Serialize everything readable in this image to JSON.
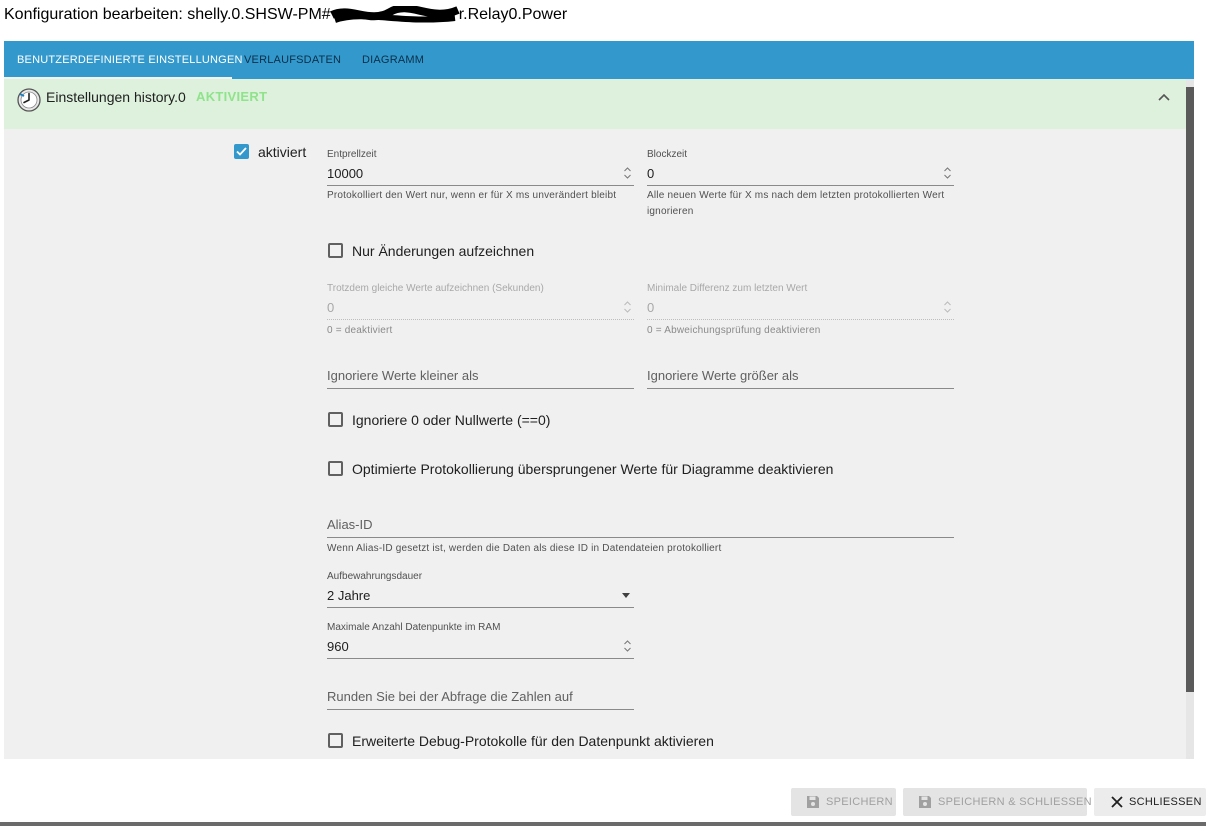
{
  "dialog": {
    "title_prefix": "Konfiguration bearbeiten: shelly.0.SHSW-PM#",
    "title_suffix": "r.Relay0.Power"
  },
  "tabs": [
    {
      "label": "BENUTZERDEFINIERTE EINSTELLUNGEN",
      "active": true
    },
    {
      "label": "VERLAUFSDATEN",
      "active": false
    },
    {
      "label": "DIAGRAMM",
      "active": false
    }
  ],
  "accordion": {
    "title": "Einstellungen history.0",
    "status": "AKTIVIERT",
    "icon": "history-clock-icon",
    "status_color": "#8fe38b"
  },
  "form": {
    "enabled": {
      "label": "aktiviert",
      "checked": true
    },
    "debounce": {
      "label": "Entprellzeit",
      "value": "10000",
      "helper": "Protokolliert den Wert nur, wenn er für X ms unverändert bleibt"
    },
    "blocktime": {
      "label": "Blockzeit",
      "value": "0",
      "helper": "Alle neuen Werte für X ms nach dem letzten protokollierten Wert ignorieren"
    },
    "changes_only": {
      "label": "Nur Änderungen aufzeichnen",
      "checked": false
    },
    "change_interval": {
      "label": "Trotzdem gleiche Werte aufzeichnen (Sekunden)",
      "value": "0",
      "helper": "0 = deaktiviert"
    },
    "min_diff": {
      "label": "Minimale Differenz zum letzten Wert",
      "value": "0",
      "helper": "0 = Abweichungsprüfung deaktivieren"
    },
    "ignore_below": {
      "placeholder": "Ignoriere Werte kleiner als"
    },
    "ignore_above": {
      "placeholder": "Ignoriere Werte größer als"
    },
    "ignore_zero": {
      "label": "Ignoriere 0 oder Nullwerte (==0)",
      "checked": false
    },
    "disable_skipped": {
      "label": "Optimierte Protokollierung übersprungener Werte für Diagramme deaktivieren",
      "checked": false
    },
    "alias": {
      "placeholder": "Alias-ID",
      "helper": "Wenn Alias-ID gesetzt ist, werden die Daten als diese ID in Datendateien protokolliert"
    },
    "retention": {
      "label": "Aufbewahrungsdauer",
      "value": "2 Jahre"
    },
    "max_ram": {
      "label": "Maximale Anzahl Datenpunkte im RAM",
      "value": "960"
    },
    "round": {
      "placeholder": "Runden Sie bei der Abfrage die Zahlen auf"
    },
    "debug": {
      "label": "Erweiterte Debug-Protokolle für den Datenpunkt aktivieren",
      "checked": false
    }
  },
  "buttons": {
    "save": "SPEICHERN",
    "save_close": "SPEICHERN & SCHLIESSEN",
    "close": "SCHLIESSEN"
  },
  "colors": {
    "accent": "#3399cc",
    "panel_bg": "#f0f0f0",
    "accordion_bg": "#ddf1dc"
  }
}
